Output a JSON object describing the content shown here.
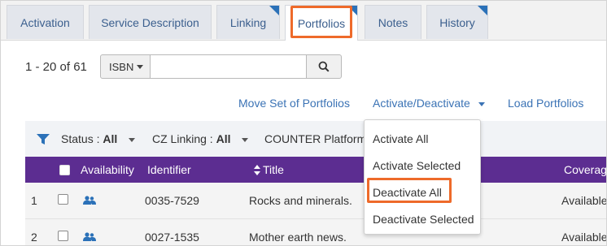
{
  "tabs": [
    {
      "label": "Activation"
    },
    {
      "label": "Service Description"
    },
    {
      "label": "Linking"
    },
    {
      "label": "Portfolios"
    },
    {
      "label": "Notes"
    },
    {
      "label": "History"
    }
  ],
  "active_tab": "Portfolios",
  "record_count": "1 - 20 of 61",
  "search": {
    "type_label": "ISBN",
    "value": "",
    "placeholder": ""
  },
  "actions": {
    "move_set": "Move Set of Portfolios",
    "activate_deactivate": "Activate/Deactivate",
    "load_portfolios": "Load Portfolios"
  },
  "filters": {
    "status_label": "Status :",
    "status_value": "All",
    "cz_label": "CZ Linking :",
    "cz_value": "All",
    "counter_label": "COUNTER Platform"
  },
  "table": {
    "headers": [
      "Availability",
      "Identifier",
      "Title",
      "Coverage"
    ],
    "rows": [
      {
        "num": "1",
        "identifier": "0035-7529",
        "title": "Rocks and minerals.",
        "coverage": "Available"
      },
      {
        "num": "2",
        "identifier": "0027-1535",
        "title": "Mother earth news.",
        "coverage": "Available"
      }
    ]
  },
  "dropdown_items": [
    "Activate All",
    "Activate Selected",
    "Deactivate All",
    "Deactivate Selected"
  ],
  "highlighted_item": "Deactivate All",
  "colors": {
    "header_purple": "#5c2d91",
    "link_blue": "#3b73b5",
    "highlight_orange": "#ee6a2a",
    "tab_corner_blue": "#2b71b8"
  }
}
